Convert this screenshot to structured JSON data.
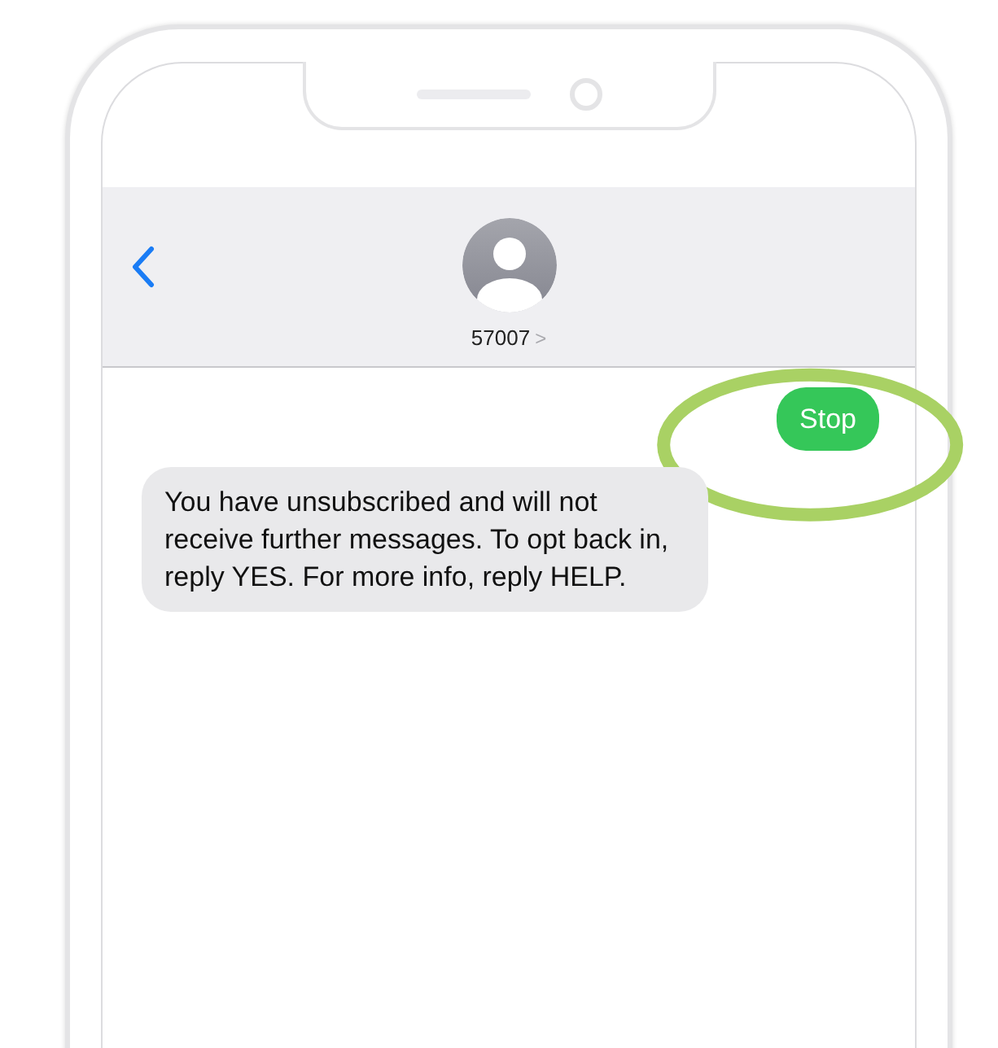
{
  "header": {
    "contact": "57007",
    "chevron": ">"
  },
  "messages": [
    {
      "kind": "sent",
      "text": "Stop",
      "highlighted": true
    },
    {
      "kind": "received",
      "text": "You have unsubscribed and will not receive further messages. To opt back in, reply YES. For more info, reply HELP.",
      "highlighted": false
    }
  ]
}
